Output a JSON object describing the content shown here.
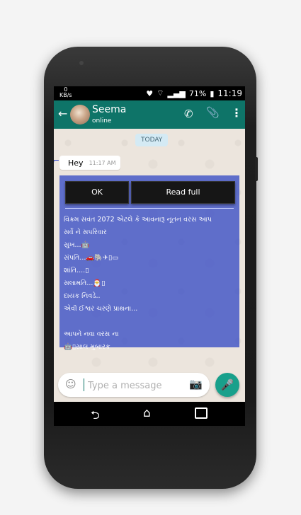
{
  "status": {
    "speed": "0",
    "speed_unit": "KB/s",
    "battery": "71%",
    "time": "11:19"
  },
  "header": {
    "contact_name": "Seema",
    "contact_status": "online"
  },
  "chat": {
    "date_separator": "TODAY",
    "messages": [
      {
        "text": "Hey",
        "time": "11:17 AM"
      }
    ]
  },
  "overlay": {
    "ok_label": "OK",
    "read_full_label": "Read full",
    "lines": [
      "વિક્રમ સવંત 2072 એટલે કે આવનારૂ નૂતન વરસ આપ",
      "સર્વે ને સપરિવાર",
      "સુખ...🤖",
      "સંપતિ...🚗🐘✈▯▭",
      "શાંતિ....▯",
      "સલામતિ...🎅▯",
      "દાયક નિવડે..",
      "એવી ઈશ્વર ચરણે પ્રાથના...",
      "",
      "આપને નવા વરસ ના",
      "🤖▯સાલ મુબારક"
    ]
  },
  "composer": {
    "placeholder": "Type a message"
  }
}
